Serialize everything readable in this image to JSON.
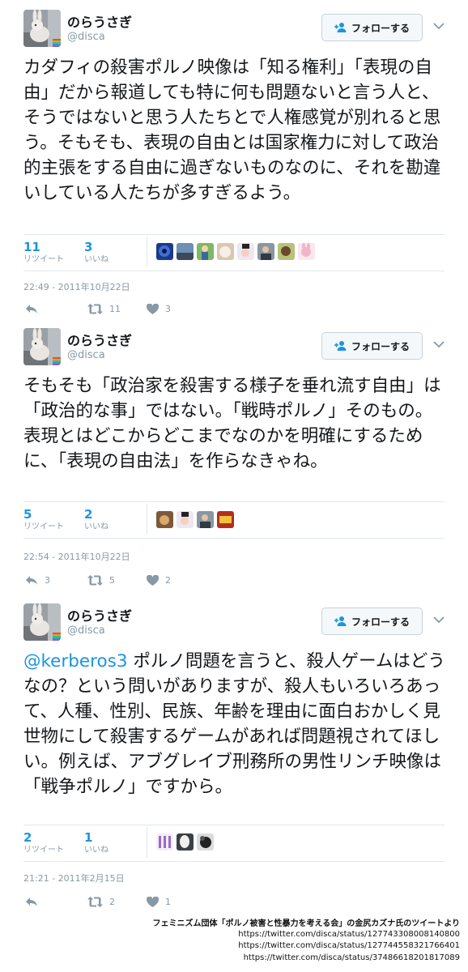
{
  "tweets": [
    {
      "display_name": "のらうさぎ",
      "handle": "@disca",
      "follow_label": "フォローする",
      "text": "カダフィの殺害ポルノ映像は「知る権利」「表現の自由」だから報道しても特に何も問題ないと言う人と、そうではないと思う人たちとで人権感覚が別れると思う。そもそも、表現の自由とは国家権力に対して政治的主張をする自由に過ぎないものなのに、それを勘違いしている人たちが多すぎるよう。",
      "mention": "",
      "retweet_count": "11",
      "retweet_label": "リツイート",
      "like_count": "3",
      "like_label": "いいね",
      "timestamp": "22:49 - 2011年10月22日",
      "action_retweet_count": "11",
      "action_like_count": "3",
      "reply_count": "",
      "liker_avatar_count": 8
    },
    {
      "display_name": "のらうさぎ",
      "handle": "@disca",
      "follow_label": "フォローする",
      "text": "そもそも「政治家を殺害する様子を垂れ流す自由」は「政治的な事」ではない。「戦時ポルノ」そのもの。表現とはどこからどこまでなのかを明確にするために、「表現の自由法」を作らなきゃね。",
      "mention": "",
      "retweet_count": "5",
      "retweet_label": "リツイート",
      "like_count": "2",
      "like_label": "いいね",
      "timestamp": "22:54 - 2011年10月22日",
      "action_retweet_count": "5",
      "action_like_count": "2",
      "reply_count": "3",
      "liker_avatar_count": 4
    },
    {
      "display_name": "のらうさぎ",
      "handle": "@disca",
      "follow_label": "フォローする",
      "mention": "@kerberos3",
      "text": " ポルノ問題を言うと、殺人ゲームはどうなの？という問いがありますが、殺人もいろいろあって、人種、性別、民族、年齢を理由に面白おかしく見世物にして殺害するゲームがあれば問題視されてほしい。例えば、アブグレイブ刑務所の男性リンチ映像は「戦争ポルノ」ですから。",
      "retweet_count": "2",
      "retweet_label": "リツイート",
      "like_count": "1",
      "like_label": "いいね",
      "timestamp": "21:21 - 2011年2月15日",
      "action_retweet_count": "2",
      "action_like_count": "1",
      "reply_count": "",
      "liker_avatar_count": 3
    }
  ],
  "credits": {
    "caption": "フェミニズム団体「ポルノ被害と性暴力を考える会」の金尻カズナ氏のツイートより",
    "urls": [
      "https://twitter.com/disca/status/127743308008140800",
      "https://twitter.com/disca/status/127744558321766401",
      "https://twitter.com/disca/status/37486618201817089"
    ]
  },
  "colors": {
    "link": "#1b95e0",
    "muted": "#8899a6",
    "divider": "#e1e8ed"
  },
  "icons": {
    "reply": "reply-icon",
    "retweet": "retweet-icon",
    "like": "heart-icon",
    "follow": "follow-person-icon",
    "more": "chevron-down-icon"
  }
}
